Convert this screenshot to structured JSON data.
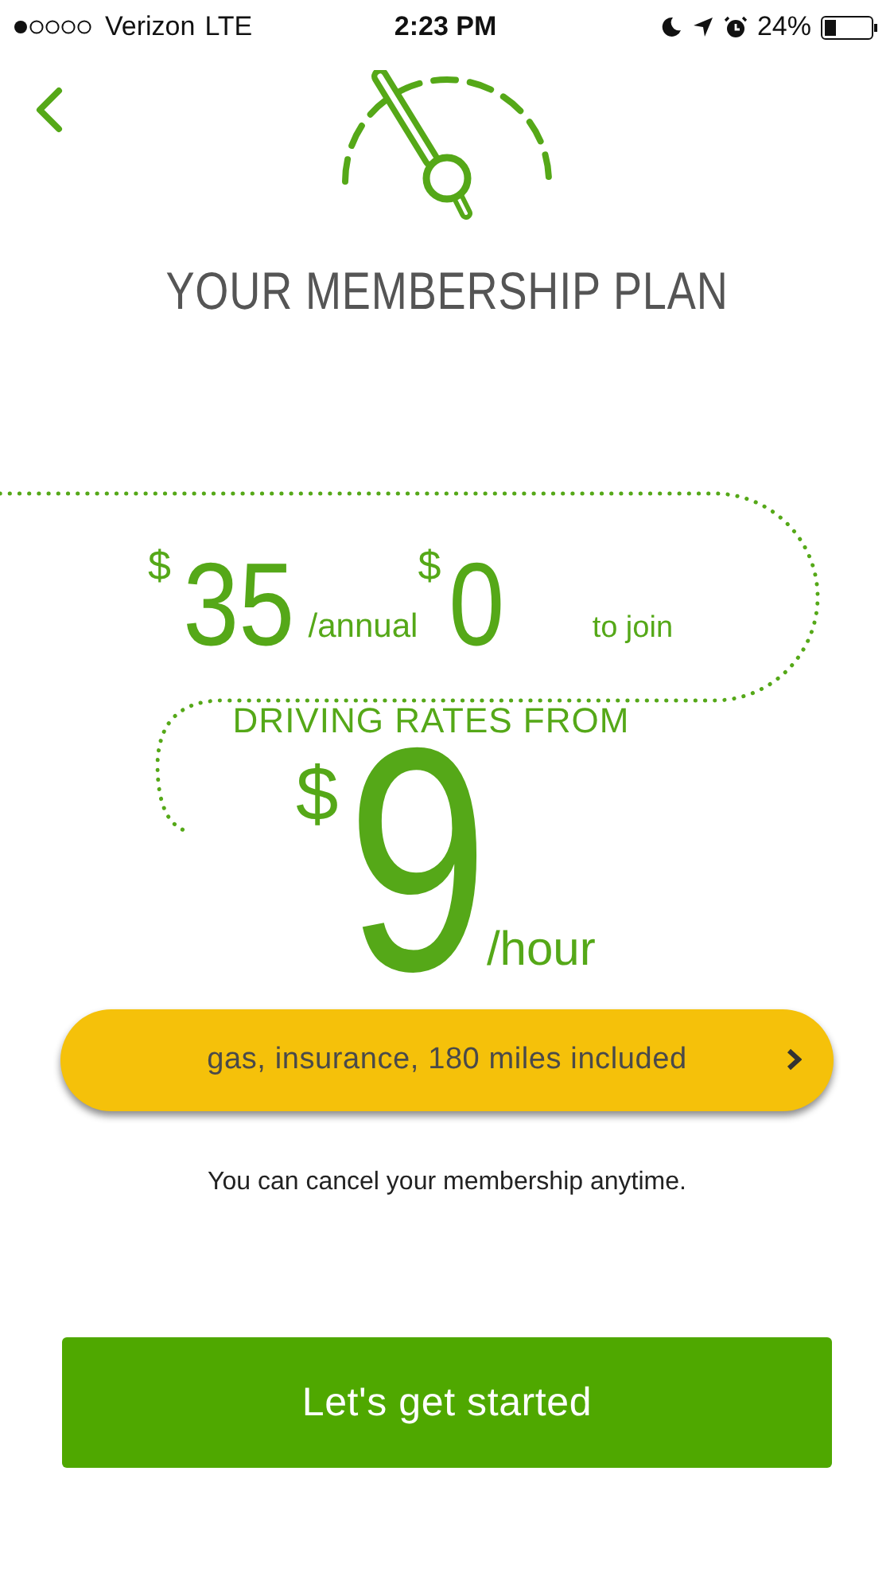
{
  "status_bar": {
    "carrier": "Verizon",
    "network": "LTE",
    "time": "2:23 PM",
    "battery_percent": "24%"
  },
  "header": {
    "title": "YOUR MEMBERSHIP PLAN"
  },
  "pricing": {
    "annual_currency": "$",
    "annual_amount": "35",
    "annual_period": "/annual",
    "join_currency": "$",
    "join_amount": "0",
    "join_label": "to join",
    "rates_label": "DRIVING RATES FROM",
    "rate_currency": "$",
    "rate_amount": "9",
    "rate_period": "/hour"
  },
  "included_button": {
    "label": "gas, insurance, 180 miles included"
  },
  "note": "You can cancel your membership anytime.",
  "cta_button": {
    "label": "Let's get started"
  }
}
